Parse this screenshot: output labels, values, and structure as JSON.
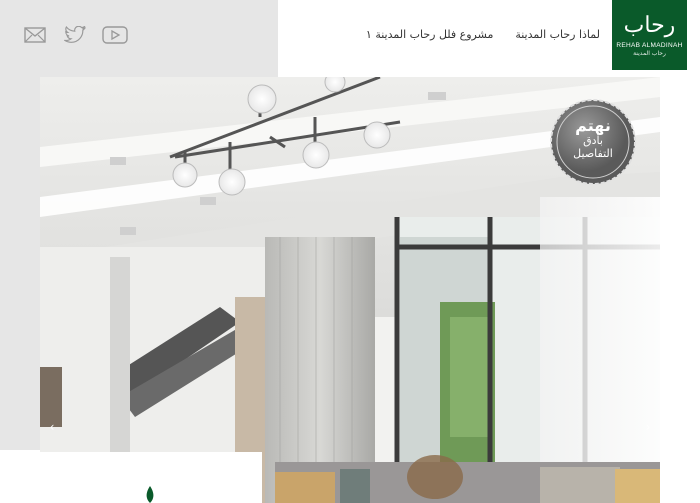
{
  "header": {
    "social": [
      {
        "name": "mail-icon"
      },
      {
        "name": "twitter-icon"
      },
      {
        "name": "youtube-icon"
      }
    ],
    "nav": [
      {
        "label": "لماذا رحاب المدينة"
      },
      {
        "label": "مشروع فلل رحاب المدينة ١"
      }
    ],
    "logo": {
      "arabic": "رحاب",
      "english": "REHAB ALMADINAH",
      "arabic_sub": "رحاب المدينة"
    }
  },
  "hero": {
    "badge": {
      "line1": "نهتم",
      "line2": "بأدق",
      "line3": "التفاصيل"
    },
    "prev_icon": "chevron-left-icon",
    "next_icon": "chevron-right-icon",
    "prev_glyph": "‹",
    "next_glyph": "›"
  },
  "colors": {
    "brand_green": "#0a5a2a",
    "panel_gray": "#e6e6e6"
  }
}
